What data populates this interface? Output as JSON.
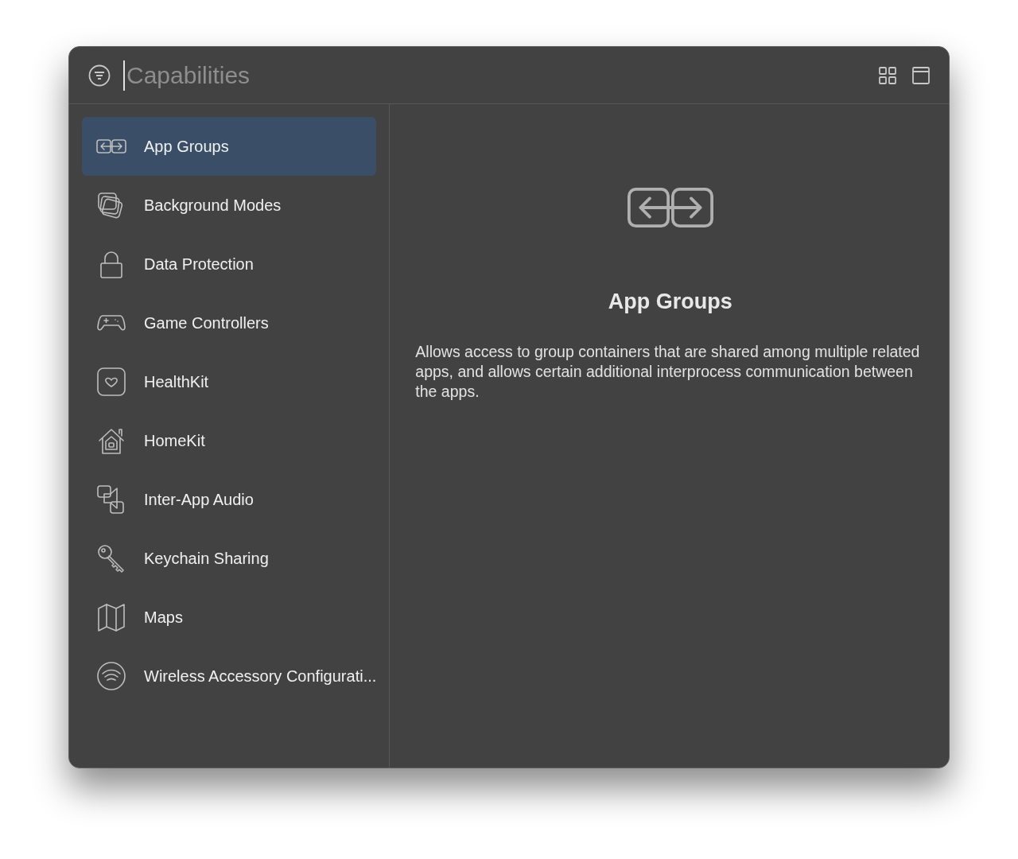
{
  "search": {
    "placeholder": "Capabilities"
  },
  "sidebar": {
    "items": [
      {
        "kind": "app-groups",
        "label": "App Groups",
        "selected": true
      },
      {
        "kind": "background",
        "label": "Background Modes",
        "selected": false
      },
      {
        "kind": "lock",
        "label": "Data Protection",
        "selected": false
      },
      {
        "kind": "gamepad",
        "label": "Game Controllers",
        "selected": false
      },
      {
        "kind": "heart",
        "label": "HealthKit",
        "selected": false
      },
      {
        "kind": "home",
        "label": "HomeKit",
        "selected": false
      },
      {
        "kind": "audio",
        "label": "Inter-App Audio",
        "selected": false
      },
      {
        "kind": "key",
        "label": "Keychain Sharing",
        "selected": false
      },
      {
        "kind": "map",
        "label": "Maps",
        "selected": false
      },
      {
        "kind": "wireless",
        "label": "Wireless Accessory Configurati...",
        "selected": false
      }
    ]
  },
  "detail": {
    "title": "App Groups",
    "description": "Allows access to group containers that are shared among multiple related apps, and allows certain additional interprocess communication between the apps."
  }
}
